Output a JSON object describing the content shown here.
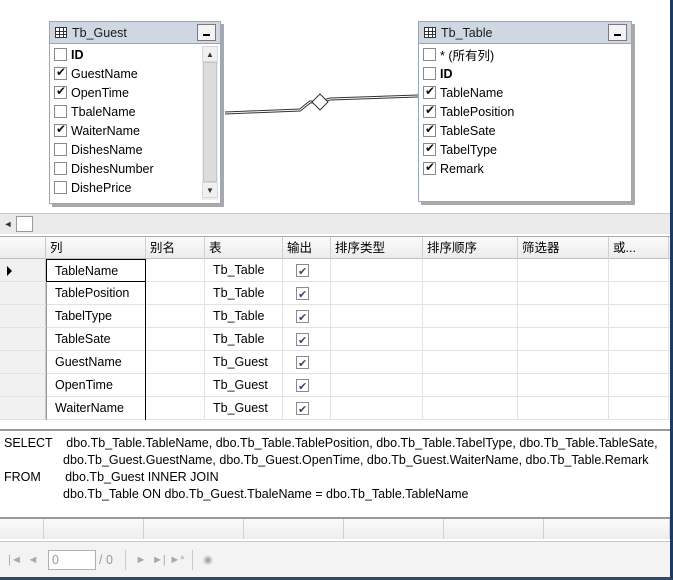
{
  "diagram": {
    "tb_guest": {
      "title": "Tb_Guest",
      "columns": [
        {
          "name": "ID",
          "checked": false,
          "bold": true
        },
        {
          "name": "GuestName",
          "checked": true,
          "bold": false
        },
        {
          "name": "OpenTime",
          "checked": true,
          "bold": false
        },
        {
          "name": "TbaleName",
          "checked": false,
          "bold": false
        },
        {
          "name": "WaiterName",
          "checked": true,
          "bold": false
        },
        {
          "name": "DishesName",
          "checked": false,
          "bold": false
        },
        {
          "name": "DishesNumber",
          "checked": false,
          "bold": false
        },
        {
          "name": "DishePrice",
          "checked": false,
          "bold": false
        }
      ]
    },
    "tb_table": {
      "title": "Tb_Table",
      "columns": [
        {
          "name": "* (所有列)",
          "checked": false,
          "bold": false
        },
        {
          "name": "ID",
          "checked": false,
          "bold": true
        },
        {
          "name": "TableName",
          "checked": true,
          "bold": false
        },
        {
          "name": "TablePosition",
          "checked": true,
          "bold": false
        },
        {
          "name": "TableSate",
          "checked": true,
          "bold": false
        },
        {
          "name": "TabelType",
          "checked": true,
          "bold": false
        },
        {
          "name": "Remark",
          "checked": true,
          "bold": false
        }
      ]
    }
  },
  "grid": {
    "headers": [
      "列",
      "别名",
      "表",
      "输出",
      "排序类型",
      "排序顺序",
      "筛选器",
      "或..."
    ],
    "rows": [
      {
        "column": "TableName",
        "alias": "",
        "table": "Tb_Table",
        "output": true
      },
      {
        "column": "TablePosition",
        "alias": "",
        "table": "Tb_Table",
        "output": true
      },
      {
        "column": "TabelType",
        "alias": "",
        "table": "Tb_Table",
        "output": true
      },
      {
        "column": "TableSate",
        "alias": "",
        "table": "Tb_Table",
        "output": true
      },
      {
        "column": "GuestName",
        "alias": "",
        "table": "Tb_Guest",
        "output": true
      },
      {
        "column": "OpenTime",
        "alias": "",
        "table": "Tb_Guest",
        "output": true
      },
      {
        "column": "WaiterName",
        "alias": "",
        "table": "Tb_Guest",
        "output": true
      }
    ]
  },
  "sql": {
    "lines": [
      "SELECT    dbo.Tb_Table.TableName, dbo.Tb_Table.TablePosition, dbo.Tb_Table.TabelType, dbo.Tb_Table.TableSate,",
      "                 dbo.Tb_Guest.GuestName, dbo.Tb_Guest.OpenTime, dbo.Tb_Guest.WaiterName, dbo.Tb_Table.Remark",
      "FROM       dbo.Tb_Guest INNER JOIN",
      "                 dbo.Tb_Table ON dbo.Tb_Guest.TbaleName = dbo.Tb_Table.TableName"
    ]
  },
  "nav": {
    "record_value": "0",
    "record_total": "/ 0"
  },
  "icons": {
    "first": "first-record-icon",
    "prev": "previous-record-icon",
    "next": "next-record-icon",
    "last": "last-record-icon",
    "new": "new-record-icon",
    "stop": "stop-icon"
  }
}
